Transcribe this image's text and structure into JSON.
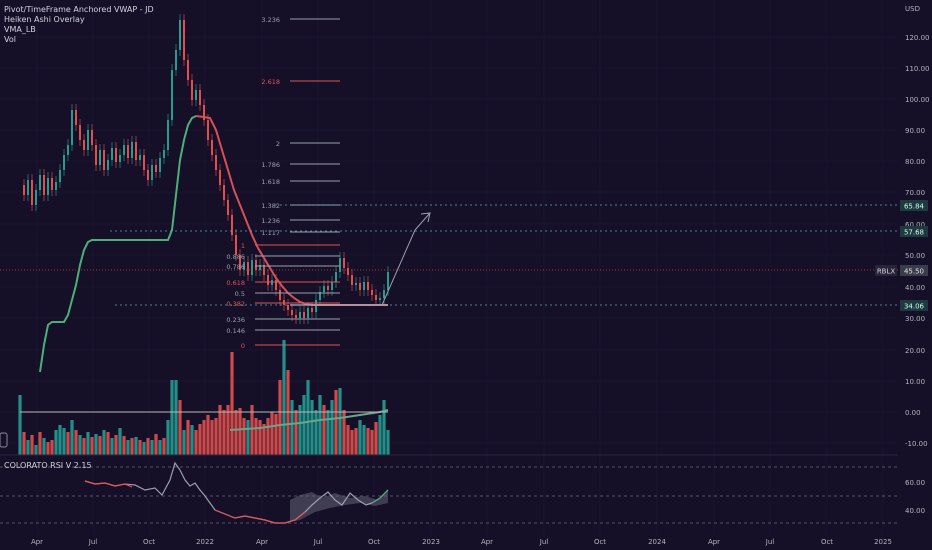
{
  "legend": {
    "line1": "Pivot/TimeFrame Anchored VWAP - JD",
    "line2": "Heiken Ashi Overlay",
    "line3": "VMA_LB",
    "line4": "Vol"
  },
  "rsi_label": "COLORATO RSI V 2.15",
  "price_axis": {
    "currency": "USD",
    "ticks": [
      "120.00",
      "110.00",
      "100.00",
      "90.00",
      "80.00",
      "70.00",
      "60.00",
      "50.00",
      "40.00",
      "30.00",
      "20.00",
      "10.00",
      "0.00",
      "-10.00"
    ]
  },
  "rsi_axis": {
    "ticks": [
      "60.00",
      "40.00"
    ]
  },
  "time_axis": {
    "labels": [
      "Apr",
      "Jul",
      "Oct",
      "2022",
      "Apr",
      "Jul",
      "Oct",
      "2023",
      "Apr",
      "Jul",
      "Oct",
      "2024",
      "Apr",
      "Jul",
      "Oct",
      "2025"
    ]
  },
  "price_badges": {
    "ticker": "RBLX",
    "current": "45.50",
    "upper1": "65.84",
    "upper2": "57.68",
    "support": "34.06"
  },
  "fib_labels": {
    "f3236": "3.236",
    "f2618": "2.618",
    "f2": "2",
    "f1786": "1.786",
    "f1618": "1.618",
    "f1382": "1.382",
    "f1236": "1.236",
    "f1117": "1.117",
    "f1": "1",
    "f0886": "0.886",
    "f0786": "0.786",
    "f0618": "0.618",
    "f05": "0.5",
    "f0382": "0.382",
    "f0236": "0.236",
    "f0146": "0.146",
    "f0": "0"
  },
  "colors": {
    "background": "#150f28",
    "up": "#26a69a",
    "down": "#ef5350",
    "vma_up": "#4caf78",
    "vma_down": "#e05656",
    "fib_red": "#e05656",
    "fib_gray": "#9aa0b0",
    "cyan_level": "#4fb3bf"
  }
}
